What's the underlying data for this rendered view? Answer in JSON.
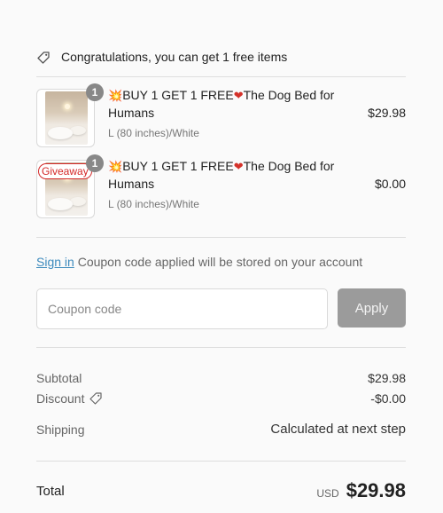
{
  "promo": {
    "icon": "tag-icon",
    "text": "Congratulations, you can get 1 free items"
  },
  "items": [
    {
      "quantity": "1",
      "emoji_prefix": "💥",
      "title_a": "BUY 1 GET 1 FREE",
      "emoji_heart": "❤",
      "title_b": "The Dog Bed for Humans",
      "variant": "L (80 inches)/White",
      "price": "$29.98",
      "badge": ""
    },
    {
      "quantity": "1",
      "emoji_prefix": "💥",
      "title_a": "BUY 1 GET 1 FREE",
      "emoji_heart": "❤",
      "title_b": "The Dog Bed for Humans",
      "variant": "L (80 inches)/White",
      "price": "$0.00",
      "badge": "Giveaway"
    }
  ],
  "account": {
    "signin_link": "Sign in",
    "signin_text": " Coupon code applied will be stored on your account"
  },
  "coupon": {
    "placeholder": "Coupon code",
    "value": "",
    "apply_label": "Apply"
  },
  "summary": {
    "subtotal_label": "Subtotal",
    "subtotal_value": "$29.98",
    "discount_label": "Discount",
    "discount_value": "-$0.00",
    "shipping_label": "Shipping",
    "shipping_value": "Calculated at next step"
  },
  "total": {
    "label": "Total",
    "currency": "USD",
    "amount": "$29.98"
  },
  "colors": {
    "link": "#3e8bbd",
    "giveaway": "#d42828",
    "apply_button": "#9b9b9b",
    "qty_badge": "#888888"
  }
}
